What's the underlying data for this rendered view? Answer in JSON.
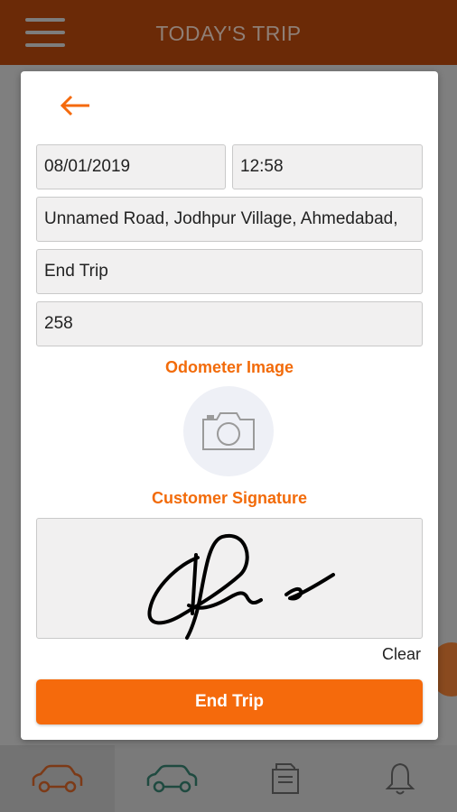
{
  "app_bar": {
    "title": "TODAY'S TRIP"
  },
  "form": {
    "date": "08/01/2019",
    "time": "12:58",
    "address": "Unnamed Road, Jodhpur Village, Ahmedabad,",
    "status": "End Trip",
    "odometer": "258",
    "odometer_image_label": "Odometer Image",
    "signature_label": "Customer Signature",
    "clear_label": "Clear",
    "submit_label": "End Trip"
  },
  "colors": {
    "accent": "#f56a0c",
    "app_bar": "#6b2a07",
    "field_bg": "#f1f0f0"
  },
  "icons": [
    "back-arrow-icon",
    "camera-icon",
    "car-icon",
    "document-icon",
    "bell-icon",
    "menu-icon"
  ]
}
